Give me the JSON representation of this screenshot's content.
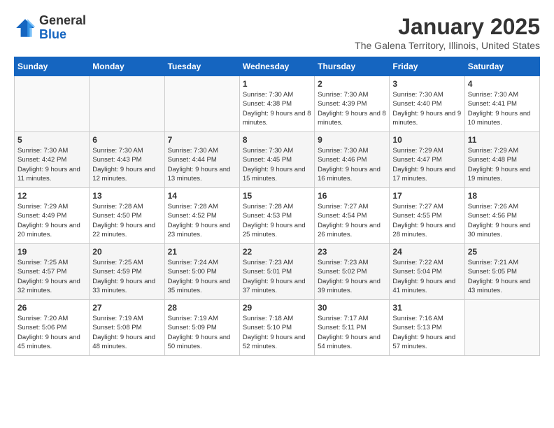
{
  "logo": {
    "general": "General",
    "blue": "Blue"
  },
  "header": {
    "title": "January 2025",
    "subtitle": "The Galena Territory, Illinois, United States"
  },
  "weekdays": [
    "Sunday",
    "Monday",
    "Tuesday",
    "Wednesday",
    "Thursday",
    "Friday",
    "Saturday"
  ],
  "weeks": [
    [
      {
        "day": "",
        "info": ""
      },
      {
        "day": "",
        "info": ""
      },
      {
        "day": "",
        "info": ""
      },
      {
        "day": "1",
        "info": "Sunrise: 7:30 AM\nSunset: 4:38 PM\nDaylight: 9 hours\nand 8 minutes."
      },
      {
        "day": "2",
        "info": "Sunrise: 7:30 AM\nSunset: 4:39 PM\nDaylight: 9 hours\nand 8 minutes."
      },
      {
        "day": "3",
        "info": "Sunrise: 7:30 AM\nSunset: 4:40 PM\nDaylight: 9 hours\nand 9 minutes."
      },
      {
        "day": "4",
        "info": "Sunrise: 7:30 AM\nSunset: 4:41 PM\nDaylight: 9 hours\nand 10 minutes."
      }
    ],
    [
      {
        "day": "5",
        "info": "Sunrise: 7:30 AM\nSunset: 4:42 PM\nDaylight: 9 hours\nand 11 minutes."
      },
      {
        "day": "6",
        "info": "Sunrise: 7:30 AM\nSunset: 4:43 PM\nDaylight: 9 hours\nand 12 minutes."
      },
      {
        "day": "7",
        "info": "Sunrise: 7:30 AM\nSunset: 4:44 PM\nDaylight: 9 hours\nand 13 minutes."
      },
      {
        "day": "8",
        "info": "Sunrise: 7:30 AM\nSunset: 4:45 PM\nDaylight: 9 hours\nand 15 minutes."
      },
      {
        "day": "9",
        "info": "Sunrise: 7:30 AM\nSunset: 4:46 PM\nDaylight: 9 hours\nand 16 minutes."
      },
      {
        "day": "10",
        "info": "Sunrise: 7:29 AM\nSunset: 4:47 PM\nDaylight: 9 hours\nand 17 minutes."
      },
      {
        "day": "11",
        "info": "Sunrise: 7:29 AM\nSunset: 4:48 PM\nDaylight: 9 hours\nand 19 minutes."
      }
    ],
    [
      {
        "day": "12",
        "info": "Sunrise: 7:29 AM\nSunset: 4:49 PM\nDaylight: 9 hours\nand 20 minutes."
      },
      {
        "day": "13",
        "info": "Sunrise: 7:28 AM\nSunset: 4:50 PM\nDaylight: 9 hours\nand 22 minutes."
      },
      {
        "day": "14",
        "info": "Sunrise: 7:28 AM\nSunset: 4:52 PM\nDaylight: 9 hours\nand 23 minutes."
      },
      {
        "day": "15",
        "info": "Sunrise: 7:28 AM\nSunset: 4:53 PM\nDaylight: 9 hours\nand 25 minutes."
      },
      {
        "day": "16",
        "info": "Sunrise: 7:27 AM\nSunset: 4:54 PM\nDaylight: 9 hours\nand 26 minutes."
      },
      {
        "day": "17",
        "info": "Sunrise: 7:27 AM\nSunset: 4:55 PM\nDaylight: 9 hours\nand 28 minutes."
      },
      {
        "day": "18",
        "info": "Sunrise: 7:26 AM\nSunset: 4:56 PM\nDaylight: 9 hours\nand 30 minutes."
      }
    ],
    [
      {
        "day": "19",
        "info": "Sunrise: 7:25 AM\nSunset: 4:57 PM\nDaylight: 9 hours\nand 32 minutes."
      },
      {
        "day": "20",
        "info": "Sunrise: 7:25 AM\nSunset: 4:59 PM\nDaylight: 9 hours\nand 33 minutes."
      },
      {
        "day": "21",
        "info": "Sunrise: 7:24 AM\nSunset: 5:00 PM\nDaylight: 9 hours\nand 35 minutes."
      },
      {
        "day": "22",
        "info": "Sunrise: 7:23 AM\nSunset: 5:01 PM\nDaylight: 9 hours\nand 37 minutes."
      },
      {
        "day": "23",
        "info": "Sunrise: 7:23 AM\nSunset: 5:02 PM\nDaylight: 9 hours\nand 39 minutes."
      },
      {
        "day": "24",
        "info": "Sunrise: 7:22 AM\nSunset: 5:04 PM\nDaylight: 9 hours\nand 41 minutes."
      },
      {
        "day": "25",
        "info": "Sunrise: 7:21 AM\nSunset: 5:05 PM\nDaylight: 9 hours\nand 43 minutes."
      }
    ],
    [
      {
        "day": "26",
        "info": "Sunrise: 7:20 AM\nSunset: 5:06 PM\nDaylight: 9 hours\nand 45 minutes."
      },
      {
        "day": "27",
        "info": "Sunrise: 7:19 AM\nSunset: 5:08 PM\nDaylight: 9 hours\nand 48 minutes."
      },
      {
        "day": "28",
        "info": "Sunrise: 7:19 AM\nSunset: 5:09 PM\nDaylight: 9 hours\nand 50 minutes."
      },
      {
        "day": "29",
        "info": "Sunrise: 7:18 AM\nSunset: 5:10 PM\nDaylight: 9 hours\nand 52 minutes."
      },
      {
        "day": "30",
        "info": "Sunrise: 7:17 AM\nSunset: 5:11 PM\nDaylight: 9 hours\nand 54 minutes."
      },
      {
        "day": "31",
        "info": "Sunrise: 7:16 AM\nSunset: 5:13 PM\nDaylight: 9 hours\nand 57 minutes."
      },
      {
        "day": "",
        "info": ""
      }
    ]
  ]
}
